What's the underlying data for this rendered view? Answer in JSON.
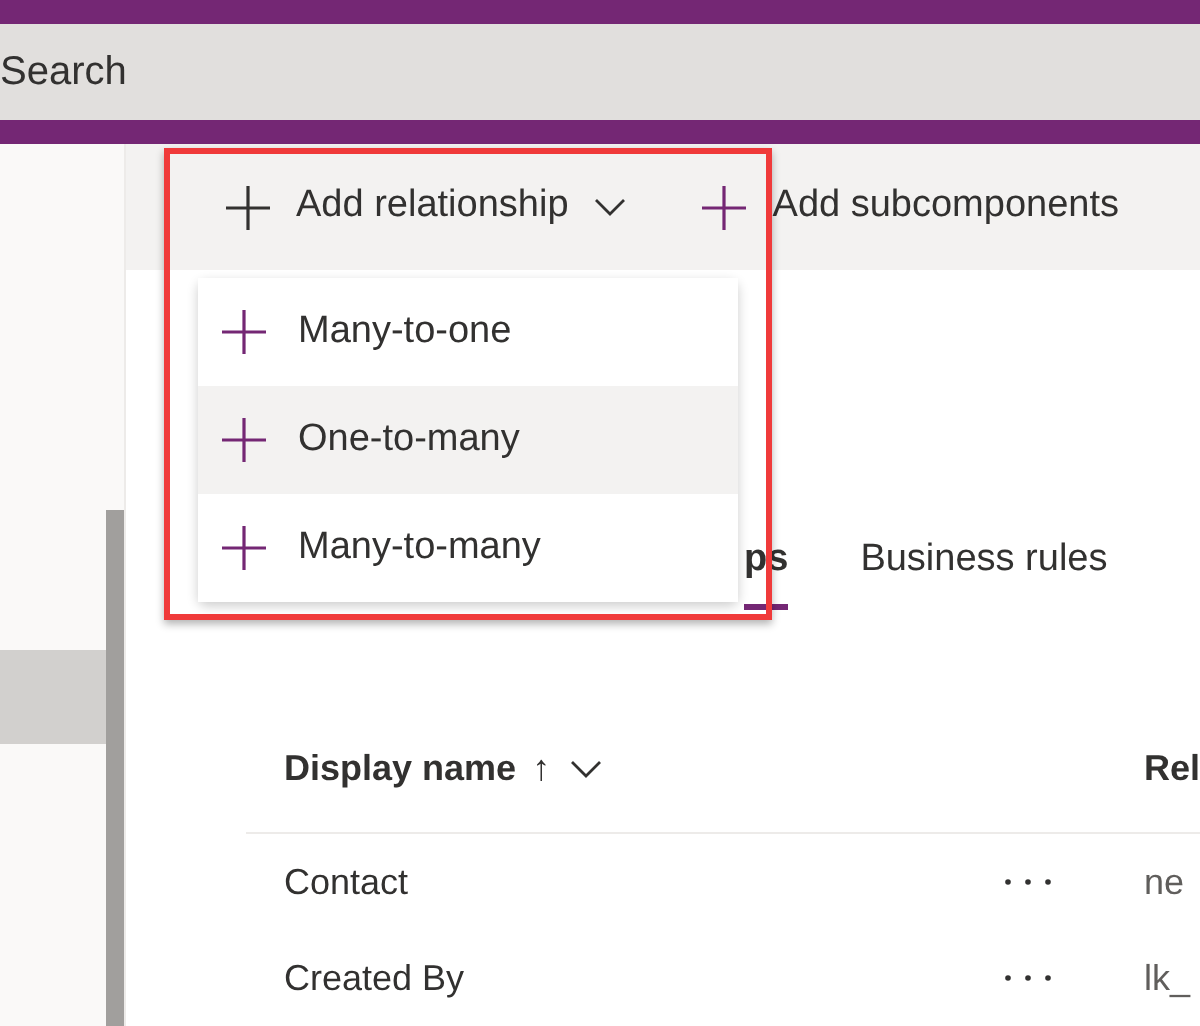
{
  "search": {
    "placeholder": "Search"
  },
  "sidebar": {
    "items": [
      {
        "selected": true
      }
    ]
  },
  "command_bar": [
    {
      "label": "Add relationship",
      "kind": "dropdown"
    },
    {
      "label": "Add subcomponents",
      "kind": "button"
    }
  ],
  "dropdown_menu": {
    "items": [
      {
        "label": "Many-to-one",
        "selected": false
      },
      {
        "label": "One-to-many",
        "selected": true
      },
      {
        "label": "Many-to-many",
        "selected": false
      }
    ]
  },
  "tabs": [
    {
      "label": "ps",
      "selected": true
    },
    {
      "label": "Business rules",
      "selected": false
    }
  ],
  "table": {
    "columns": [
      {
        "label": "Display name",
        "sort_indicator": "↑"
      },
      {
        "label": "Rel"
      }
    ],
    "rows": [
      {
        "display_name": "Contact",
        "column_2": "ne"
      },
      {
        "display_name": "Created By",
        "column_2": "lk_"
      }
    ]
  }
}
